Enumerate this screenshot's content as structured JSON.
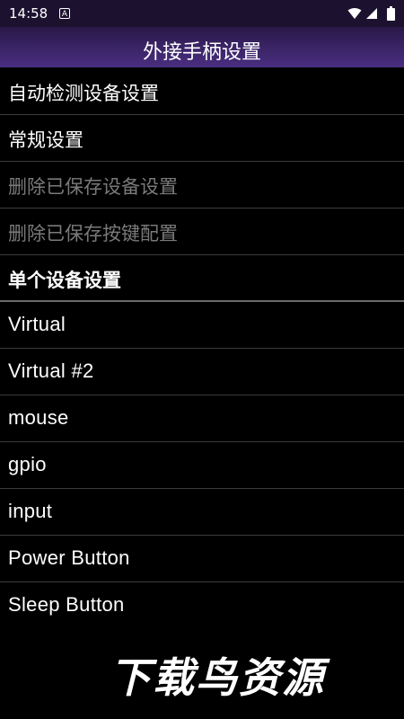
{
  "status_bar": {
    "time": "14:58",
    "notification_letter": "A",
    "icons": [
      "wifi-icon",
      "signal-icon",
      "battery-icon"
    ]
  },
  "title_bar": {
    "title": "外接手柄设置"
  },
  "menu": {
    "items": [
      {
        "label": "自动检测设备设置",
        "enabled": true
      },
      {
        "label": "常规设置",
        "enabled": true
      },
      {
        "label": "删除已保存设备设置",
        "enabled": false
      },
      {
        "label": "删除已保存按键配置",
        "enabled": false
      }
    ],
    "section_header": "单个设备设置",
    "devices": [
      "Virtual",
      "Virtual #2",
      "mouse",
      "gpio",
      "input",
      "Power Button",
      "Sleep Button"
    ]
  },
  "watermark": {
    "text": "下载鸟资源"
  },
  "colors": {
    "title_bar": "#3a2466",
    "background": "#000000",
    "disabled_text": "#7a7a7a",
    "divider": "#3c3c3c"
  }
}
